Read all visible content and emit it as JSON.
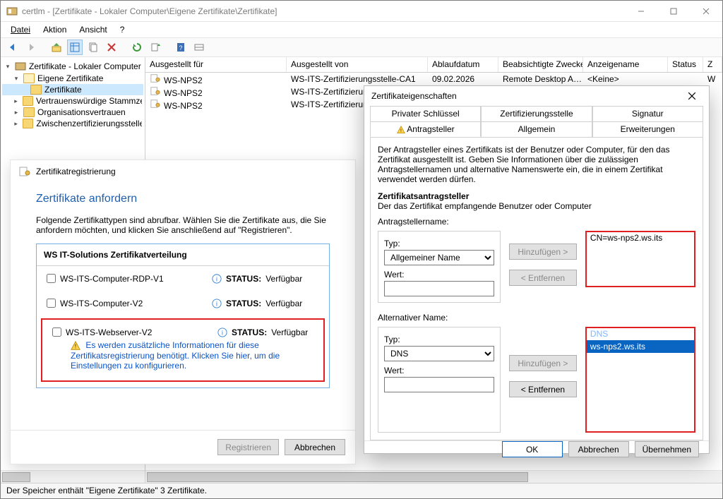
{
  "colors": {
    "accent": "#0a64c2",
    "red": "#e02020",
    "link": "#0953c5",
    "heading": "#1f5fae"
  },
  "titlebar": {
    "title": "certlm - [Zertifikate - Lokaler Computer\\Eigene Zertifikate\\Zertifikate]"
  },
  "menu": {
    "items": [
      {
        "label": "Datei",
        "u": "D"
      },
      {
        "label": "Aktion",
        "u": "k"
      },
      {
        "label": "Ansicht",
        "u": "A"
      },
      {
        "label": "?",
        "u": "?"
      }
    ]
  },
  "tree": {
    "root": "Zertifikate - Lokaler Computer",
    "own": "Eigene Zertifikate",
    "certs": "Zertifikate",
    "trusted": "Vertrauenswürdige Stammzertifizierungsstellen",
    "org": "Organisationsvertrauen",
    "interm": "Zwischenzertifizierungsstellen"
  },
  "list": {
    "cols": {
      "c0": "Ausgestellt für",
      "c1": "Ausgestellt von",
      "c2": "Ablaufdatum",
      "c3": "Beabsichtigte Zwecke",
      "c4": "Anzeigename",
      "c5": "Status",
      "c6": "Z"
    },
    "rows": [
      {
        "for": "WS-NPS2",
        "by": "WS-ITS-Zertifizierungsstelle-CA1",
        "exp": "09.02.2026",
        "purpose": "Remote Desktop A…",
        "disp": "<Keine>",
        "status": "",
        "z": "W"
      },
      {
        "for": "WS-NPS2",
        "by": "WS-ITS-Zertifizierungsstelle",
        "exp": "",
        "purpose": "",
        "disp": "",
        "status": "",
        "z": "W"
      },
      {
        "for": "WS-NPS2",
        "by": "WS-ITS-Zertifizierungsstelle",
        "exp": "",
        "purpose": "",
        "disp": "",
        "status": "",
        "z": "W"
      }
    ]
  },
  "wizard": {
    "title": "Zertifikatregistrierung",
    "heading": "Zertifikate anfordern",
    "desc1": "Folgende Zertifikattypen sind abrufbar. Wählen Sie die Zertifikate aus, die Sie anfordern möchten, und klicken Sie anschließend auf \"Registrieren\".",
    "group": "WS IT-Solutions Zertifikatverteilung",
    "status_label": "STATUS:",
    "status_value": "Verfügbar",
    "tpl1": "WS-ITS-Computer-RDP-V1",
    "tpl2": "WS-ITS-Computer-V2",
    "tpl3": "WS-ITS-Webserver-V2",
    "warn": "Es werden zusätzliche Informationen für diese Zertifikatsregistrierung benötigt. Klicken Sie hier, um die Einstellungen zu konfigurieren.",
    "btn_register": "Registrieren",
    "btn_cancel": "Abbrechen"
  },
  "props": {
    "title": "Zertifikateigenschaften",
    "tabs_row1": {
      "a": "Privater Schlüssel",
      "b": "Zertifizierungsstelle",
      "c": "Signatur"
    },
    "tabs_row2": {
      "a": "Antragsteller",
      "b": "Allgemein",
      "c": "Erweiterungen"
    },
    "intro": "Der Antragsteller eines Zertifikats ist der Benutzer oder Computer, für den das Zertifikat ausgestellt ist. Geben Sie Informationen über die zulässigen Antragstellernamen und alternative Namenswerte ein, die in einem Zertifikat verwendet werden dürfen.",
    "subj_hdr": "Zertifikatsantragsteller",
    "subj_sub": "Der das Zertifikat empfangende Benutzer oder Computer",
    "subj_name_lbl": "Antragstellername:",
    "type_lbl": "Typ:",
    "type_cn": "Allgemeiner Name",
    "value_lbl": "Wert:",
    "cn_entry": "CN=ws-nps2.ws.its",
    "alt_hdr": "Alternativer Name:",
    "type_dns": "DNS",
    "dns_hdr": "DNS",
    "dns_entry": "ws-nps2.ws.its",
    "btn_add": "Hinzufügen >",
    "btn_remove": "< Entfernen",
    "btn_ok": "OK",
    "btn_cancel": "Abbrechen",
    "btn_apply": "Übernehmen"
  },
  "statusbar": {
    "text": "Der Speicher enthält \"Eigene Zertifikate\" 3 Zertifikate."
  }
}
